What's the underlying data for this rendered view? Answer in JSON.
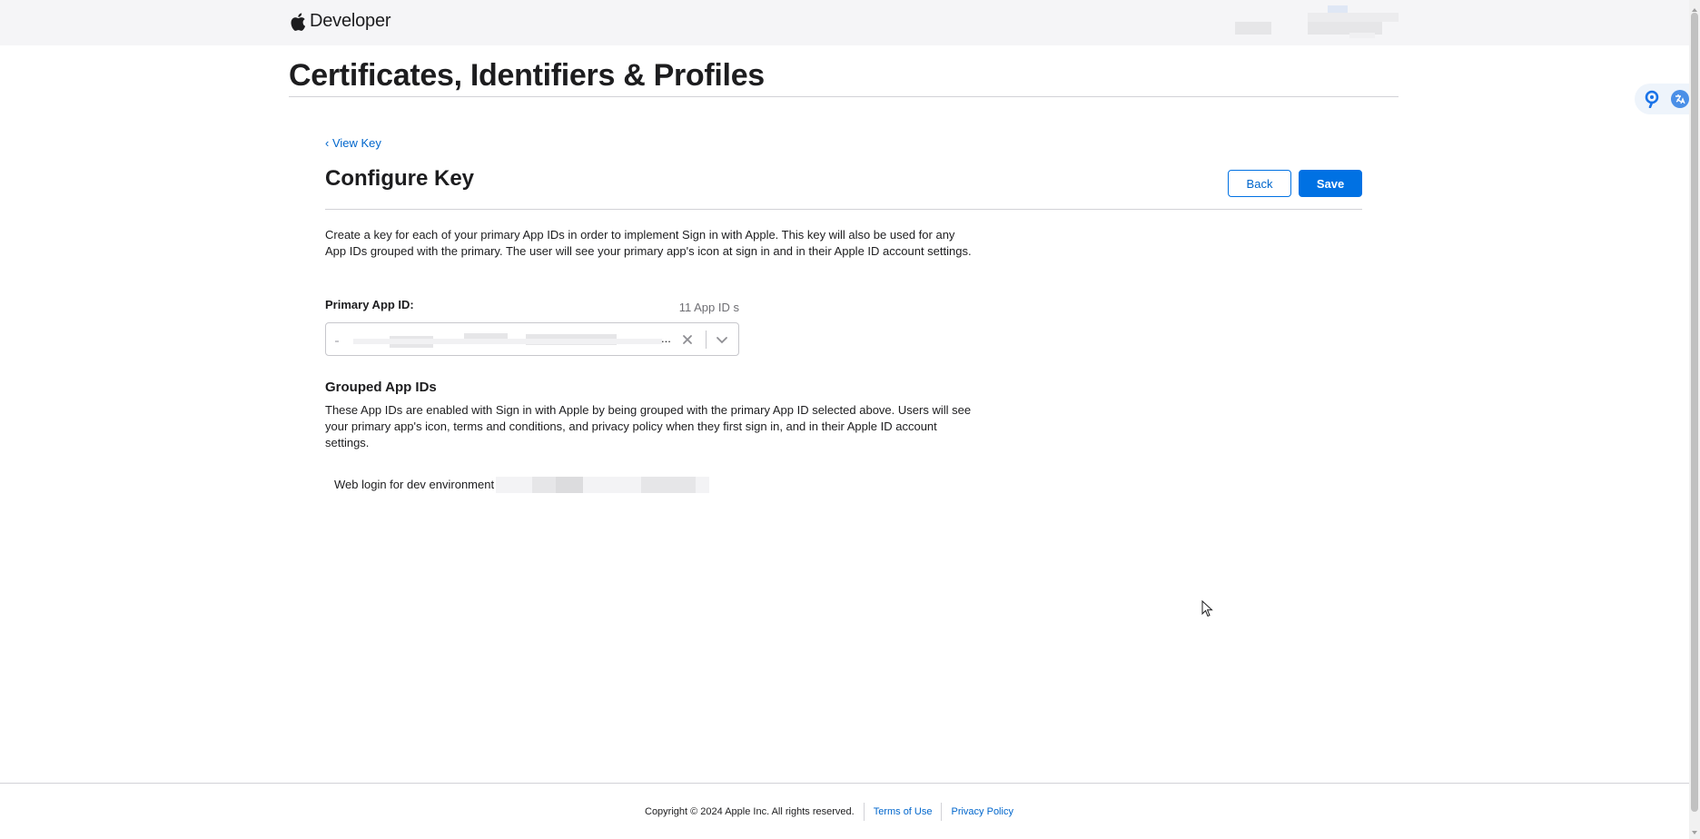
{
  "header": {
    "logo_icon": "apple-logo-icon",
    "brand": "Developer"
  },
  "page": {
    "title": "Certificates, Identifiers & Profiles"
  },
  "extensions": {
    "icons": [
      "search-extension-icon",
      "translate-extension-icon"
    ]
  },
  "configure": {
    "back_link": "‹ View Key",
    "title": "Configure Key",
    "back_button": "Back",
    "save_button": "Save",
    "description": "Create a key for each of your primary App IDs in order to implement Sign in with Apple. This key will also be used for any App IDs grouped with the primary. The user will see your primary app's icon at sign in and in their Apple ID account settings."
  },
  "primary_app_id": {
    "label": "Primary App ID:",
    "count": "11 App ID s",
    "value_visible": "...",
    "clear_icon": "close-icon",
    "dropdown_icon": "chevron-down-icon"
  },
  "grouped": {
    "title": "Grouped App IDs",
    "description": "These App IDs are enabled with Sign in with Apple by being grouped with the primary App ID selected above. Users will see your primary app's icon, terms and conditions, and privacy policy when they first sign in, and in their Apple ID account settings.",
    "items": [
      {
        "label": "Web login for dev environment"
      }
    ]
  },
  "footer": {
    "copyright": "Copyright © 2024 Apple Inc. All rights reserved.",
    "terms": "Terms of Use",
    "privacy": "Privacy Policy"
  },
  "colors": {
    "accent": "#0071e3",
    "link": "#0066cc",
    "text": "#1d1d1f",
    "header_bg": "#f5f5f7"
  }
}
